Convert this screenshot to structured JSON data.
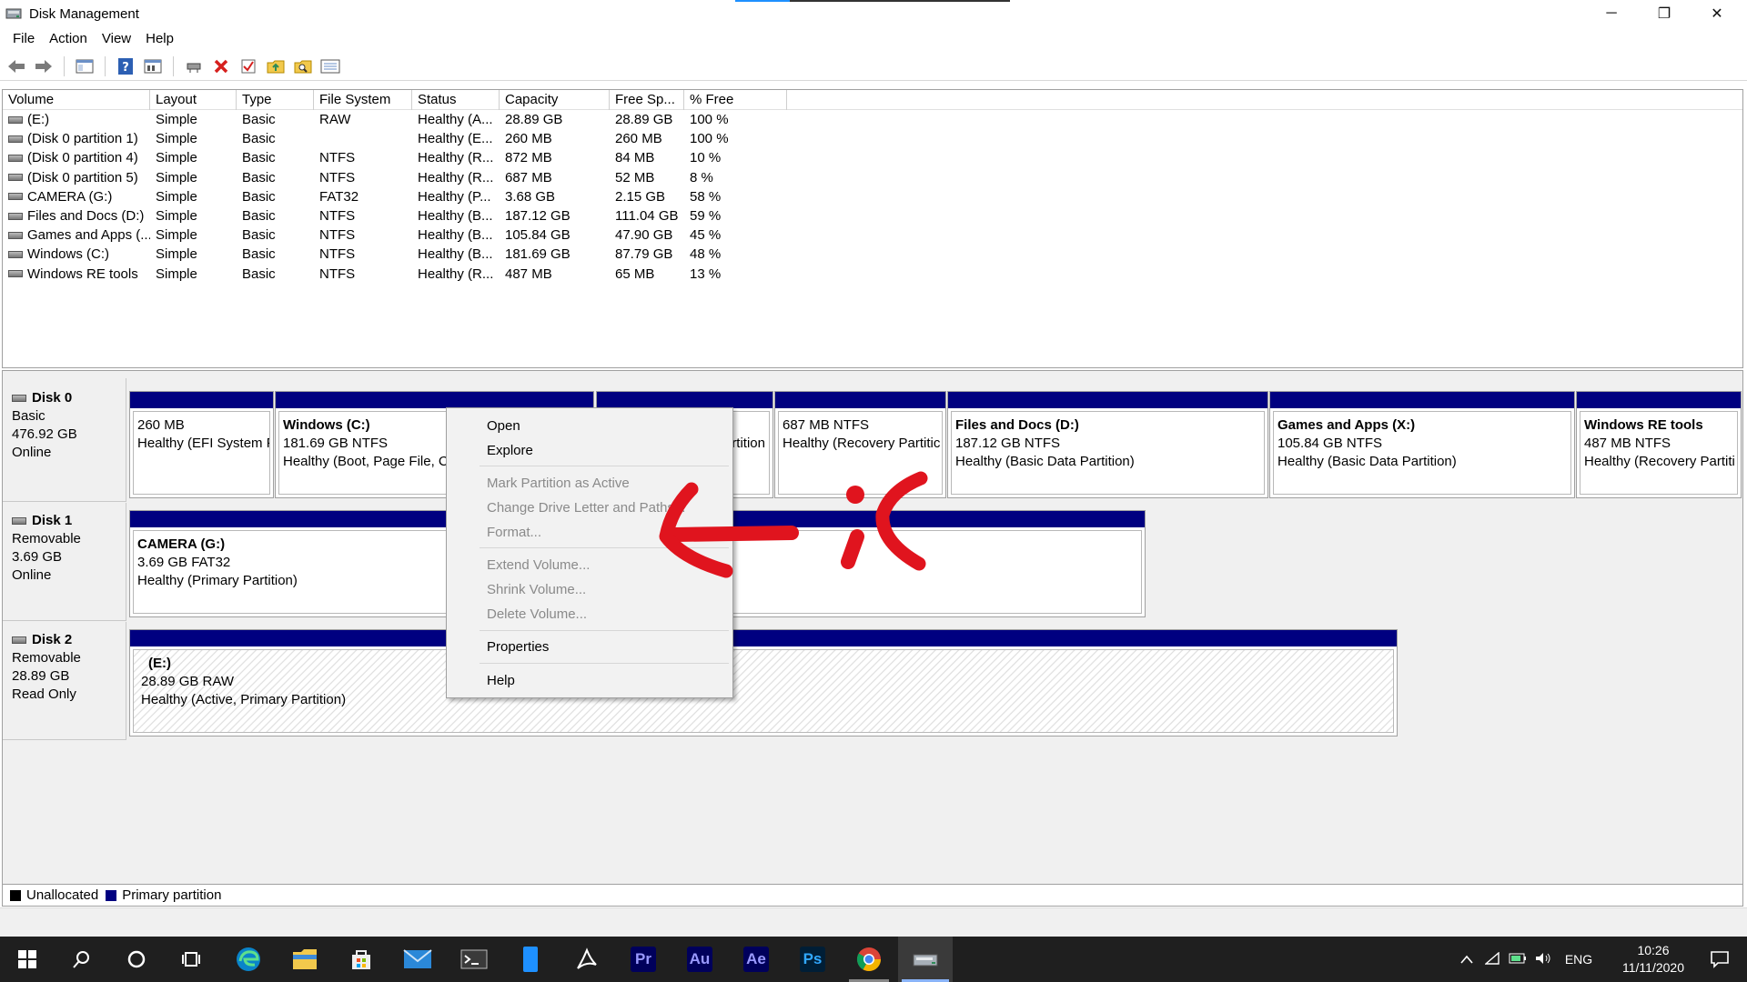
{
  "window": {
    "title": "Disk Management",
    "minimize_glyph": "─",
    "maximize_glyph": "❐",
    "close_glyph": "✕"
  },
  "menu": [
    "File",
    "Action",
    "View",
    "Help"
  ],
  "toolbar": {
    "icons": [
      "back-arrow-icon",
      "forward-arrow-icon",
      "console-tree-icon",
      "help-icon",
      "properties-view-icon",
      "connect-disk-icon",
      "delete-icon",
      "check-icon",
      "folder-up-icon",
      "folder-search-icon",
      "list-view-icon"
    ]
  },
  "volume_table": {
    "columns": [
      "Volume",
      "Layout",
      "Type",
      "File System",
      "Status",
      "Capacity",
      "Free Sp...",
      "% Free"
    ],
    "rows": [
      [
        "(E:)",
        "Simple",
        "Basic",
        "RAW",
        "Healthy (A...",
        "28.89 GB",
        "28.89 GB",
        "100 %"
      ],
      [
        "(Disk 0 partition 1)",
        "Simple",
        "Basic",
        "",
        "Healthy (E...",
        "260 MB",
        "260 MB",
        "100 %"
      ],
      [
        "(Disk 0 partition 4)",
        "Simple",
        "Basic",
        "NTFS",
        "Healthy (R...",
        "872 MB",
        "84 MB",
        "10 %"
      ],
      [
        "(Disk 0 partition 5)",
        "Simple",
        "Basic",
        "NTFS",
        "Healthy (R...",
        "687 MB",
        "52 MB",
        "8 %"
      ],
      [
        "CAMERA (G:)",
        "Simple",
        "Basic",
        "FAT32",
        "Healthy (P...",
        "3.68 GB",
        "2.15 GB",
        "58 %"
      ],
      [
        "Files and Docs (D:)",
        "Simple",
        "Basic",
        "NTFS",
        "Healthy (B...",
        "187.12 GB",
        "111.04 GB",
        "59 %"
      ],
      [
        "Games and Apps (...",
        "Simple",
        "Basic",
        "NTFS",
        "Healthy (B...",
        "105.84 GB",
        "47.90 GB",
        "45 %"
      ],
      [
        "Windows (C:)",
        "Simple",
        "Basic",
        "NTFS",
        "Healthy (B...",
        "181.69 GB",
        "87.79 GB",
        "48 %"
      ],
      [
        "Windows RE tools",
        "Simple",
        "Basic",
        "NTFS",
        "Healthy (R...",
        "487 MB",
        "65 MB",
        "13 %"
      ]
    ]
  },
  "disks": [
    {
      "name": "Disk 0",
      "kind": "Basic",
      "size": "476.92 GB",
      "state": "Online",
      "partitions": [
        {
          "name": "",
          "size": "260 MB",
          "status": "Healthy (EFI System P"
        },
        {
          "name": "Windows  (C:)",
          "size": "181.69 GB NTFS",
          "status": "Healthy (Boot, Page File, Cr"
        },
        {
          "name": "",
          "size": "",
          "status": "rtition"
        },
        {
          "name": "",
          "size": "687 MB NTFS",
          "status": "Healthy (Recovery Partitic"
        },
        {
          "name": "Files and Docs  (D:)",
          "size": "187.12 GB NTFS",
          "status": "Healthy (Basic Data Partition)"
        },
        {
          "name": "Games and Apps  (X:)",
          "size": "105.84 GB NTFS",
          "status": "Healthy (Basic Data Partition)"
        },
        {
          "name": "Windows RE tools",
          "size": "487 MB NTFS",
          "status": "Healthy (Recovery Partiti"
        }
      ]
    },
    {
      "name": "Disk 1",
      "kind": "Removable",
      "size": "3.69 GB",
      "state": "Online",
      "partitions": [
        {
          "name": "CAMERA  (G:)",
          "size": "3.69 GB FAT32",
          "status": "Healthy (Primary Partition)"
        }
      ]
    },
    {
      "name": "Disk 2",
      "kind": "Removable",
      "size": "28.89 GB",
      "state": "Read Only",
      "partitions": [
        {
          "name": "(E:)",
          "size": "28.89 GB RAW",
          "status": "Healthy (Active, Primary Partition)"
        }
      ]
    }
  ],
  "legend": [
    {
      "label": "Unallocated",
      "color": "#000000"
    },
    {
      "label": "Primary partition",
      "color": "#000080"
    }
  ],
  "context_menu": {
    "items": [
      {
        "label": "Open",
        "enabled": true
      },
      {
        "label": "Explore",
        "enabled": true
      },
      {
        "label": "Mark Partition as Active",
        "enabled": false
      },
      {
        "label": "Change Drive Letter and Paths...",
        "enabled": false
      },
      {
        "label": "Format...",
        "enabled": false
      },
      {
        "label": "Extend Volume...",
        "enabled": false
      },
      {
        "label": "Shrink Volume...",
        "enabled": false
      },
      {
        "label": "Delete Volume...",
        "enabled": false
      },
      {
        "label": "Properties",
        "enabled": true
      },
      {
        "label": "Help",
        "enabled": true
      }
    ]
  },
  "annotation": {
    "color": "#e0141e"
  },
  "taskbar": {
    "apps": [
      "start-icon",
      "search-icon",
      "cortana-icon",
      "task-view-icon",
      "edge-icon",
      "file-explorer-icon",
      "store-icon",
      "mail-icon",
      "terminal-icon",
      "phone-icon",
      "acrobat-icon",
      "premiere-icon",
      "audition-icon",
      "after-effects-icon",
      "photoshop-icon",
      "chrome-icon",
      "disk-management-icon"
    ],
    "adobe": {
      "premiere": "Pr",
      "audition": "Au",
      "after_effects": "Ae",
      "photoshop": "Ps"
    },
    "language": "ENG",
    "time": "10:26",
    "date": "11/11/2020"
  }
}
